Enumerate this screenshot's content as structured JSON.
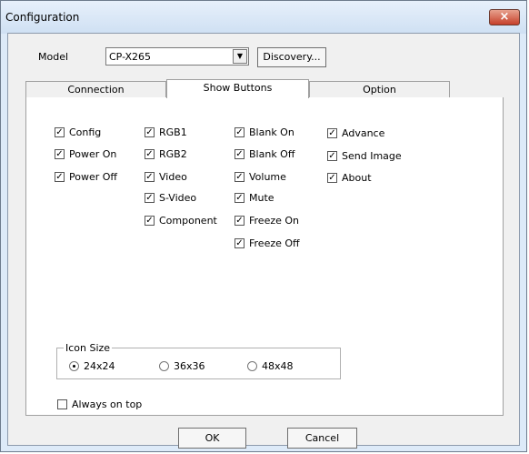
{
  "window": {
    "title": "Configuration",
    "close_glyph": "×"
  },
  "model": {
    "label": "Model",
    "value": "CP-X265",
    "discovery_label": "Discovery..."
  },
  "tabs": [
    {
      "label": "Connection"
    },
    {
      "label": "Show Buttons"
    },
    {
      "label": "Option"
    }
  ],
  "checkboxes": [
    {
      "label": "Config",
      "checked": true
    },
    {
      "label": "Power On",
      "checked": true
    },
    {
      "label": "Power Off",
      "checked": true
    },
    {
      "label": "RGB1",
      "checked": true
    },
    {
      "label": "RGB2",
      "checked": true
    },
    {
      "label": "Video",
      "checked": true
    },
    {
      "label": "S-Video",
      "checked": true
    },
    {
      "label": "Component",
      "checked": true
    },
    {
      "label": "Blank On",
      "checked": true
    },
    {
      "label": "Blank Off",
      "checked": true
    },
    {
      "label": "Volume",
      "checked": true
    },
    {
      "label": "Mute",
      "checked": true
    },
    {
      "label": "Freeze On",
      "checked": true
    },
    {
      "label": "Freeze Off",
      "checked": true
    },
    {
      "label": "Advance",
      "checked": true
    },
    {
      "label": "Send Image",
      "checked": true
    },
    {
      "label": "About",
      "checked": true
    }
  ],
  "icon_size": {
    "title": "Icon Size",
    "options": [
      {
        "label": "24x24",
        "selected": true
      },
      {
        "label": "36x36",
        "selected": false
      },
      {
        "label": "48x48",
        "selected": false
      }
    ]
  },
  "always_on_top": {
    "label": "Always on top",
    "checked": false
  },
  "footer": {
    "ok_label": "OK",
    "cancel_label": "Cancel"
  }
}
